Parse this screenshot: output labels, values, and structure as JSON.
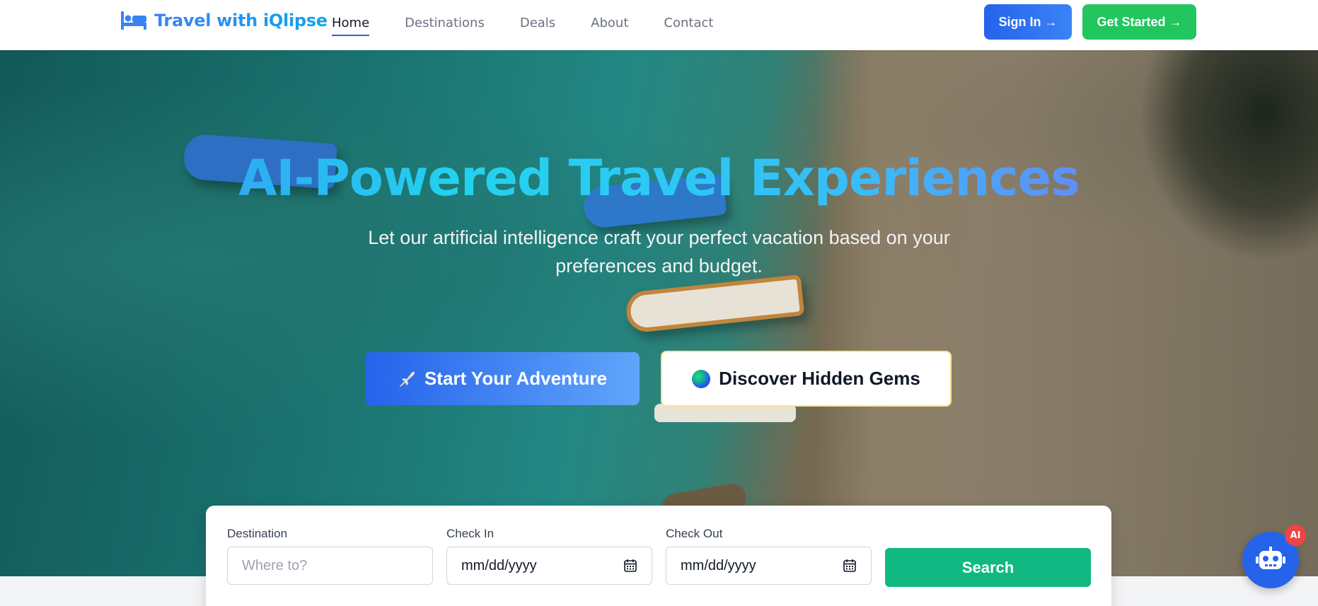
{
  "brand": {
    "name": "Travel with iQlipse",
    "icon": "bed-icon"
  },
  "nav": {
    "links": [
      {
        "label": "Home",
        "active": true
      },
      {
        "label": "Destinations",
        "active": false
      },
      {
        "label": "Deals",
        "active": false
      },
      {
        "label": "About",
        "active": false
      },
      {
        "label": "Contact",
        "active": false
      }
    ],
    "signin_label": "Sign In →",
    "get_started_label": "Get Started →"
  },
  "hero": {
    "title": "AI-Powered Travel Experiences",
    "subtitle": "Let our artificial intelligence craft your perfect vacation based on your preferences and budget.",
    "primary_cta": "Start Your Adventure",
    "secondary_cta": "Discover Hidden Gems"
  },
  "search": {
    "destination_label": "Destination",
    "destination_placeholder": "Where to?",
    "checkin_label": "Check In",
    "checkin_value": "mm/dd/yyyy",
    "checkout_label": "Check Out",
    "checkout_value": "mm/dd/yyyy",
    "button_label": "Search"
  },
  "chatbot": {
    "badge": "AI",
    "icon": "robot-icon"
  },
  "colors": {
    "primary": "#2563eb",
    "success": "#22c55e",
    "search": "#10b981"
  }
}
